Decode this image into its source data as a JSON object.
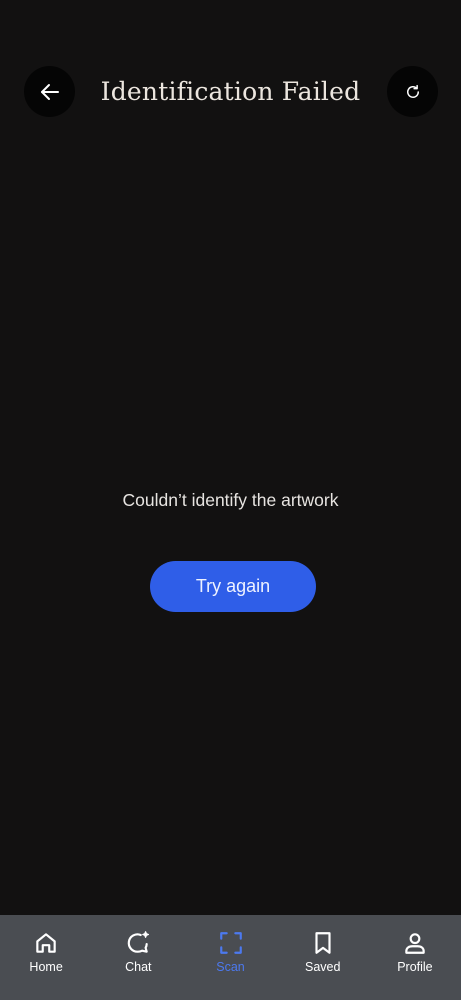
{
  "header": {
    "title": "Identification Failed",
    "back_icon": "arrow-left-icon",
    "refresh_icon": "refresh-icon"
  },
  "main": {
    "message": "Couldn’t identify the artwork",
    "try_again_label": "Try again"
  },
  "bottom_nav": {
    "items": [
      {
        "label": "Home",
        "icon": "home-icon",
        "active": false
      },
      {
        "label": "Chat",
        "icon": "chat-sparkle-icon",
        "active": false
      },
      {
        "label": "Scan",
        "icon": "scan-icon",
        "active": true
      },
      {
        "label": "Saved",
        "icon": "bookmark-icon",
        "active": false
      },
      {
        "label": "Profile",
        "icon": "user-icon",
        "active": false
      }
    ]
  },
  "colors": {
    "background": "#121111",
    "accent": "#2f5ee8",
    "active_nav": "#4c79ef",
    "nav_background": "#4a4d52"
  }
}
